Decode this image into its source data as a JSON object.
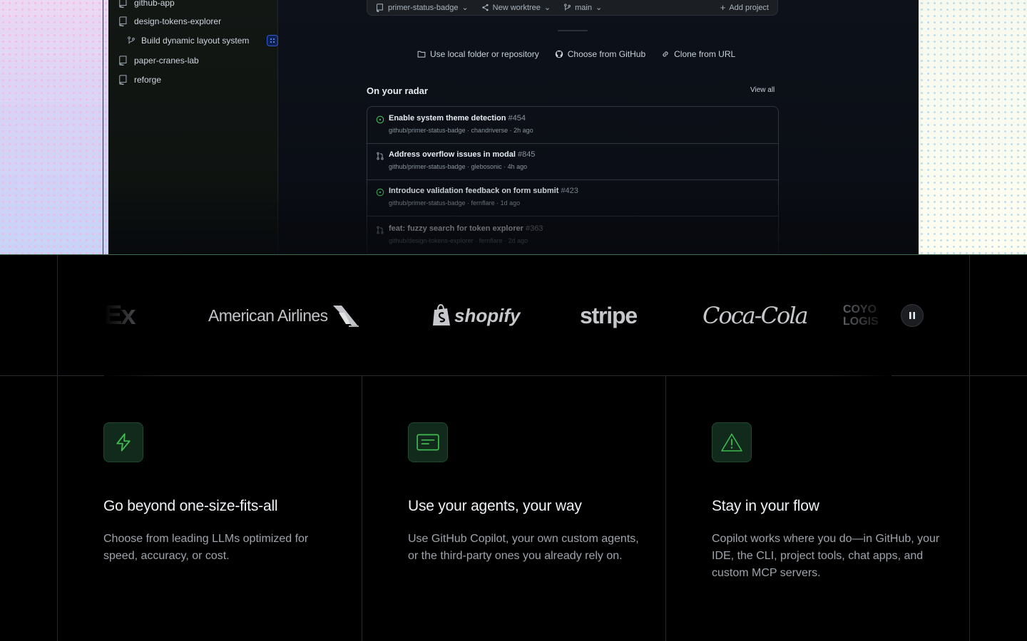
{
  "sidebar": {
    "items": [
      {
        "label": "github-app",
        "icon": "repo-icon"
      },
      {
        "label": "design-tokens-explorer",
        "icon": "repo-icon"
      },
      {
        "label": "Build dynamic layout system",
        "icon": "branch-icon"
      },
      {
        "label": "paper-cranes-lab",
        "icon": "repo-icon"
      },
      {
        "label": "reforge",
        "icon": "repo-icon"
      }
    ]
  },
  "prompt_bar": {
    "repo": "primer-status-badge",
    "worktree": "New worktree",
    "branch": "main",
    "add_project": "Add project"
  },
  "sources": {
    "local": "Use local folder or repository",
    "github": "Choose from GitHub",
    "url": "Clone from URL"
  },
  "radar": {
    "title": "On your radar",
    "view_all": "View all",
    "items": [
      {
        "title": "Enable system theme detection",
        "number": "#454",
        "meta": "github/primer-status-badge · chandriverse · 2h ago",
        "kind": "issue-open-icon"
      },
      {
        "title": "Address overflow issues in modal",
        "number": "#845",
        "meta": "github/primer-status-badge · glebosonic · 4h ago",
        "kind": "pull-request-icon"
      },
      {
        "title": "Introduce validation feedback on form submit",
        "number": "#423",
        "meta": "github/primer-status-badge · fernflare · 1d ago",
        "kind": "issue-open-icon"
      },
      {
        "title": "feat: fuzzy search for token explorer",
        "number": "#363",
        "meta": "github/design-tokens-explorer · fernflare · 2d ago",
        "kind": "pull-request-icon"
      }
    ]
  },
  "logos": {
    "items": [
      "FedEx",
      "American Airlines",
      "shopify",
      "stripe",
      "Coca-Cola",
      "COYOTE LOGISTICS"
    ],
    "fedex_visible": "Ex",
    "aa": "American Airlines",
    "shopify": "shopify",
    "stripe": "stripe",
    "coke": "Coca-Cola",
    "coyote_line1": "COYO",
    "coyote_line2": "LOGIS",
    "pause_label": "Pause logo carousel"
  },
  "features": [
    {
      "icon": "lightning-icon",
      "title": "Go beyond one-size-fits-all",
      "desc": "Choose from leading LLMs optimized for speed, accuracy, or cost."
    },
    {
      "icon": "message-icon",
      "title": "Use your agents, your way",
      "desc": "Use GitHub Copilot, your own custom agents, or the third-party ones you already rely on."
    },
    {
      "icon": "alert-triangle-icon",
      "title": "Stay in your flow",
      "desc": "Copilot works where you do—in GitHub, your IDE, the CLI, project tools, chat apps, and custom MCP servers."
    }
  ],
  "colors": {
    "accent_green": "#3fb950",
    "icon_bg": "#112a1c",
    "background": "#000000"
  }
}
